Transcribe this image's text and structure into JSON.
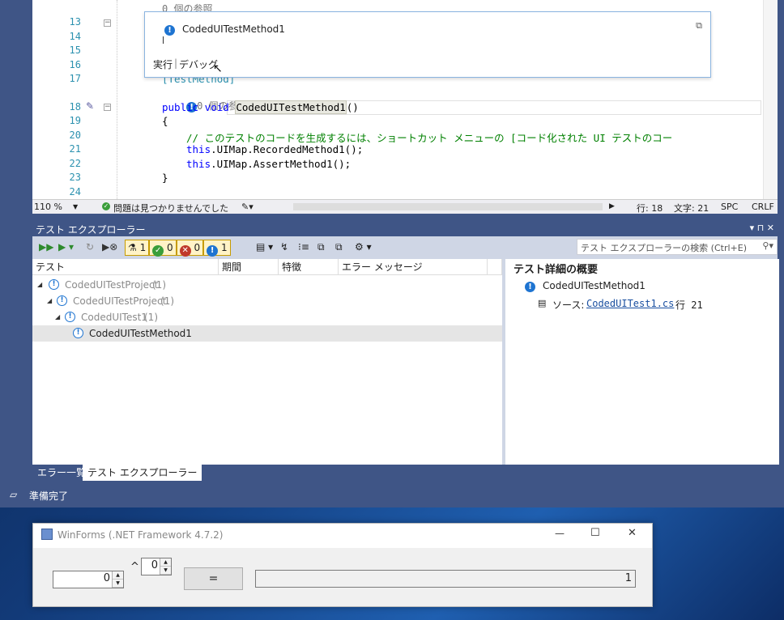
{
  "editor": {
    "refs_label_top": "0 個の参照",
    "line_numbers": [
      "13",
      "14",
      "15",
      "16",
      "17",
      "18",
      "19",
      "20",
      "21",
      "22",
      "23",
      "24"
    ],
    "attribute_line": "[TestMethod]",
    "refs_label": "0 個の参照",
    "method_decl_kw": "public void ",
    "method_name": "CodedUITestMethod1",
    "method_parens": "()",
    "brace_open": "{",
    "comment": "// このテストのコードを生成するには、ショートカット メニューの [コード化された UI テストのコー",
    "call1_this": "this",
    "call1_rest": ".UIMap.RecordedMethod1();",
    "call2_this": "this",
    "call2_rest": ".UIMap.AssertMethod1();",
    "brace_close": "}"
  },
  "popup": {
    "title": "CodedUITestMethod1",
    "run_link": "実行",
    "debug_link": "デバッグ",
    "separator": "|"
  },
  "editor_status": {
    "zoom": "110 %",
    "issues": "問題は見つかりませんでした",
    "line": "行: 18",
    "col": "文字: 21",
    "spc": "SPC",
    "crlf": "CRLF"
  },
  "test_explorer": {
    "title": "テスト エクスプローラー",
    "pin_glyphs": "▾ ⊓ ✕",
    "filters": {
      "flask_count": "1",
      "passed_count": "0",
      "failed_count": "0",
      "notrun_count": "1"
    },
    "search_placeholder": "テスト エクスプローラーの検索 (Ctrl+E)",
    "columns": [
      "テスト",
      "期間",
      "特徴",
      "エラー メッセージ"
    ],
    "tree": [
      {
        "label": "CodedUITestProject",
        "count": "(1)"
      },
      {
        "label": "CodedUITestProject",
        "count": "(1)"
      },
      {
        "label": "CodedUITest1",
        "count": "(1)"
      },
      {
        "label": "CodedUITestMethod1",
        "count": ""
      }
    ],
    "detail": {
      "heading": "テスト詳細の概要",
      "method": "CodedUITestMethod1",
      "source_label": "ソース:",
      "source_link": "CodedUITest1.cs",
      "source_line": "行 21"
    }
  },
  "bottom_tabs": [
    "エラー一覧",
    "テスト エクスプローラー"
  ],
  "status_bar": {
    "text": "準備完了"
  },
  "winforms": {
    "title": "WinForms (.NET Framework 4.7.2)",
    "base_value": "0",
    "caret": "^",
    "exp_value": "0",
    "equals_label": "=",
    "result": "1",
    "min_glyph": "—",
    "max_glyph": "☐",
    "close_glyph": "✕"
  },
  "colors": {
    "vs_frame": "#3f5586",
    "info_blue": "#1e74d1",
    "pass_green": "#3a9e3a",
    "fail_red": "#c0392b"
  }
}
